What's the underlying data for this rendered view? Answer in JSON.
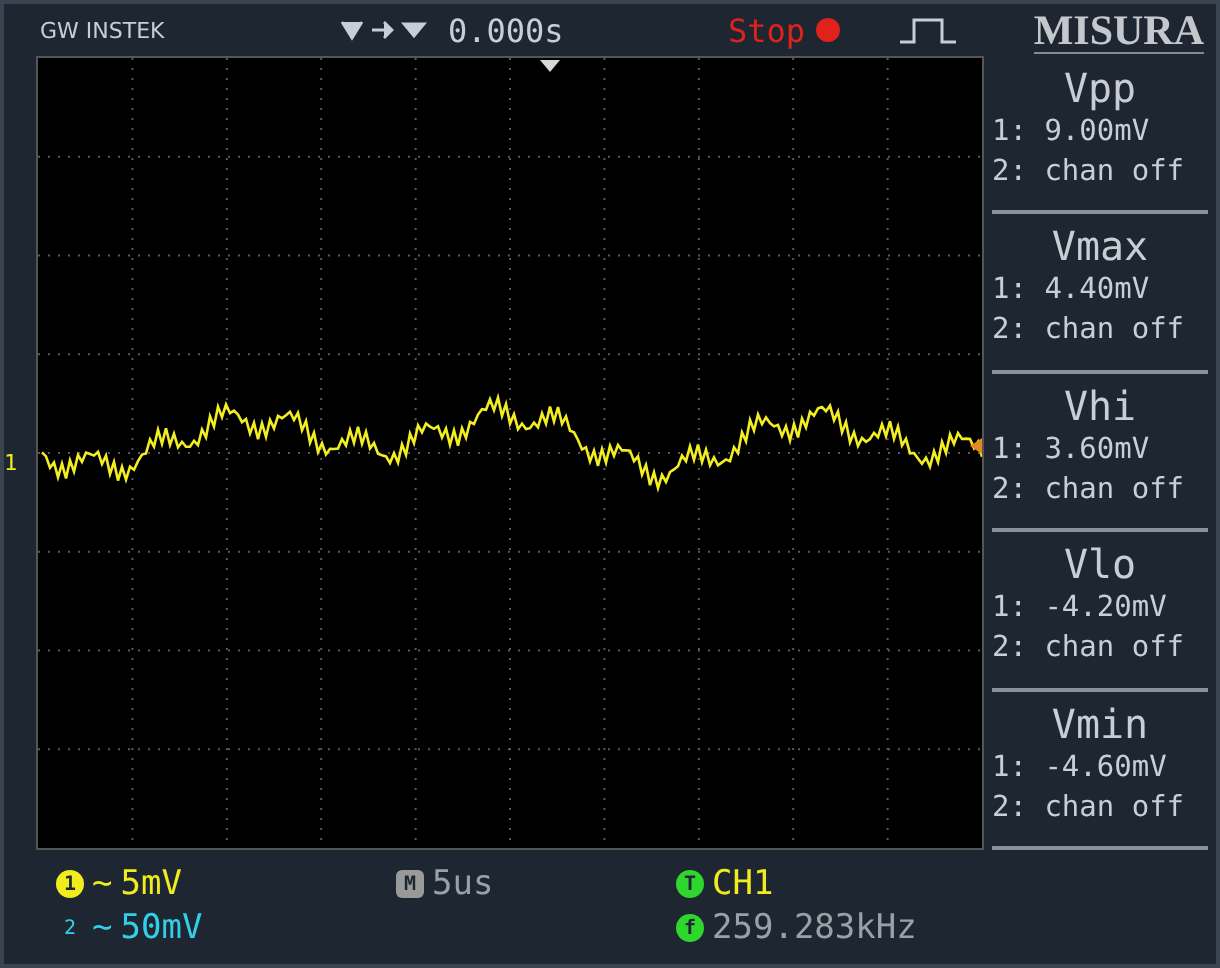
{
  "header": {
    "brand": "GW INSTEK",
    "time_offset": "0.000s",
    "run_state": "Stop",
    "menu_title": "MISURA"
  },
  "channel_marker": "1",
  "measurements": [
    {
      "name": "Vpp",
      "ch1": "1: 9.00mV",
      "ch2": "2: chan off"
    },
    {
      "name": "Vmax",
      "ch1": "1: 4.40mV",
      "ch2": "2: chan off"
    },
    {
      "name": "Vhi",
      "ch1": "1: 3.60mV",
      "ch2": "2: chan off"
    },
    {
      "name": "Vlo",
      "ch1": "1: -4.20mV",
      "ch2": "2: chan off"
    },
    {
      "name": "Vmin",
      "ch1": "1: -4.60mV",
      "ch2": "2: chan off"
    }
  ],
  "status": {
    "ch1": {
      "badge": "1",
      "coupling": "~",
      "scale": "5mV"
    },
    "ch2": {
      "badge": "2",
      "coupling": "~",
      "scale": "50mV"
    },
    "timebase": {
      "badge": "M",
      "value": "5us"
    },
    "trigger": {
      "badge": "T",
      "source": "CH1"
    },
    "frequency": {
      "badge": "f",
      "value": "259.283kHz"
    }
  }
}
